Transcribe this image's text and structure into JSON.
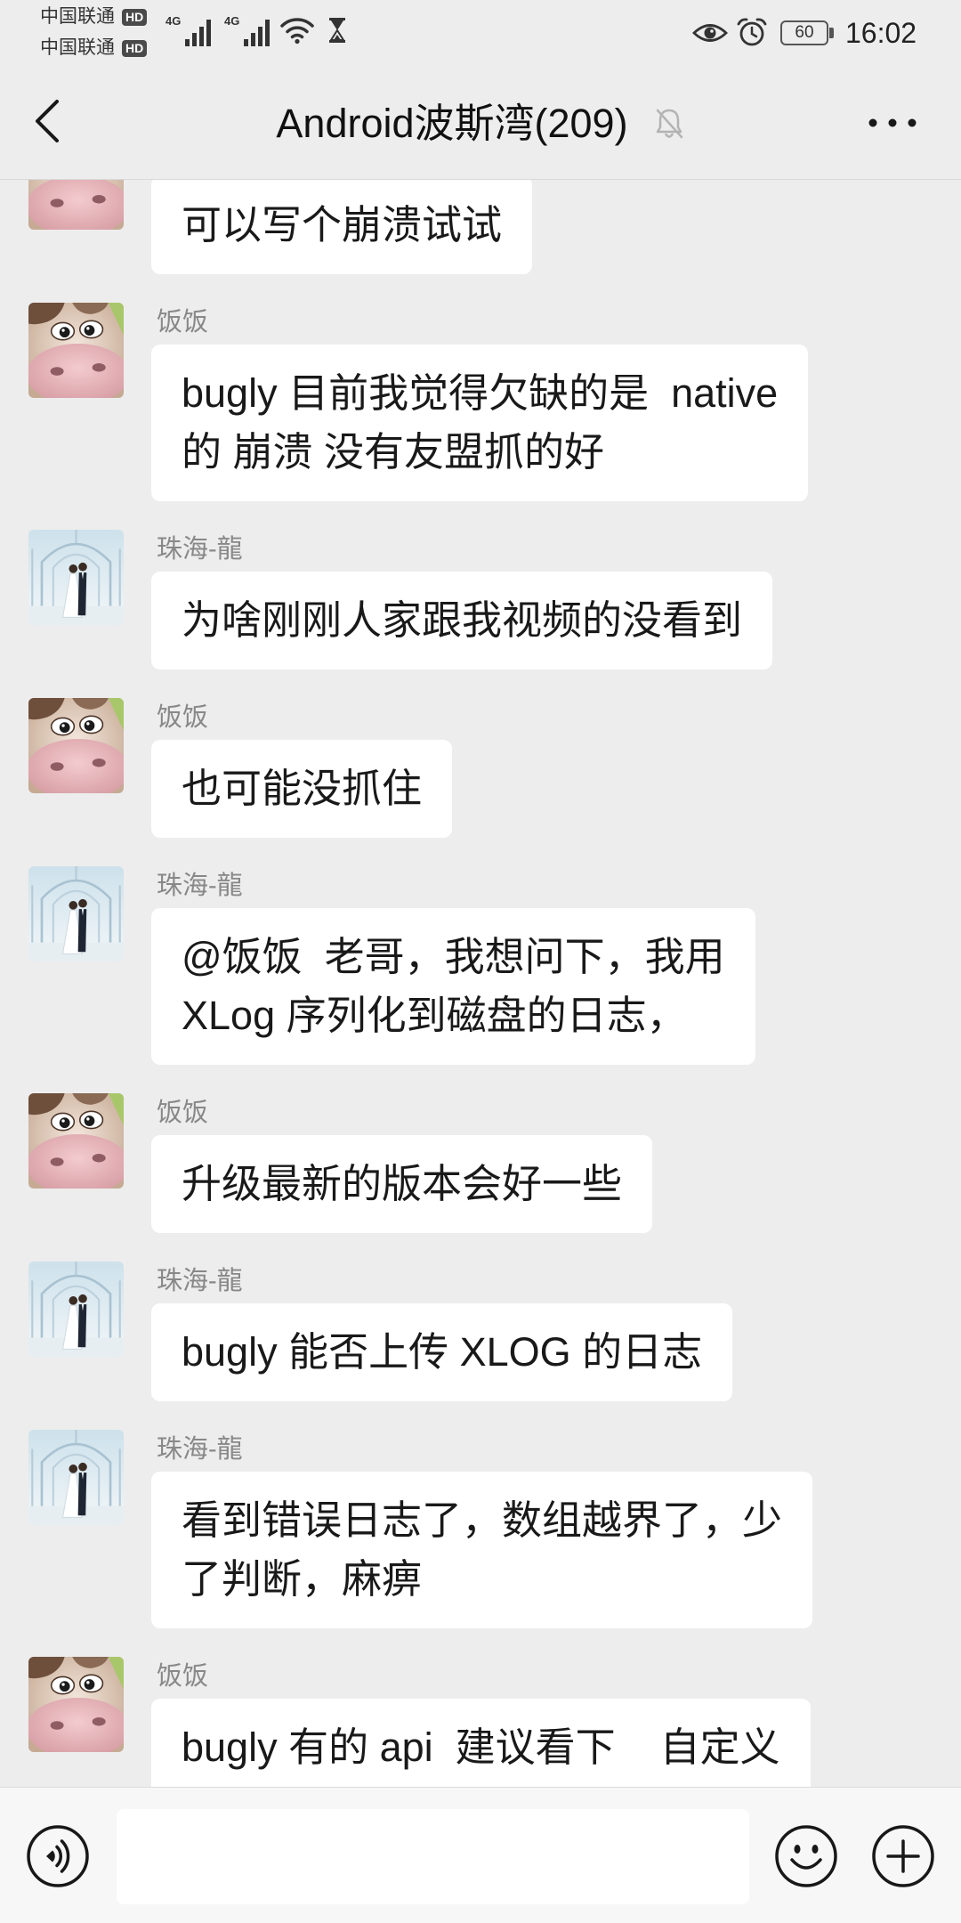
{
  "status_bar": {
    "carriers": [
      {
        "name": "中国联通",
        "badge": "HD"
      },
      {
        "name": "中国联通",
        "badge": "HD"
      }
    ],
    "networks": [
      "4G",
      "4G"
    ],
    "battery": "60",
    "time": "16:02",
    "icons": [
      "signal-icon",
      "wifi-icon",
      "hourglass-icon",
      "eye-icon",
      "alarm-icon",
      "battery-icon"
    ]
  },
  "header": {
    "title": "Android波斯湾(209)",
    "icons": {
      "back": "back-arrow-icon",
      "mute": "mute-bell-icon",
      "more": "more-dots-icon"
    }
  },
  "messages": [
    {
      "avatar": "cow-avatar",
      "lines": [
        "可以写个崩溃试试"
      ]
    },
    {
      "sender": "饭饭",
      "avatar": "cow-avatar",
      "lines": [
        "bugly 目前我觉得欠缺的是  native",
        "的 崩溃 没有友盟抓的好"
      ]
    },
    {
      "sender": "珠海-龍",
      "avatar": "wedding-avatar",
      "lines": [
        "为啥刚刚人家跟我视频的没看到"
      ]
    },
    {
      "sender": "饭饭",
      "avatar": "cow-avatar",
      "lines": [
        "也可能没抓住"
      ]
    },
    {
      "sender": "珠海-龍",
      "avatar": "wedding-avatar",
      "lines": [
        "@饭饭  老哥，我想问下，我用",
        "XLog 序列化到磁盘的日志，"
      ]
    },
    {
      "sender": "饭饭",
      "avatar": "cow-avatar",
      "lines": [
        "升级最新的版本会好一些"
      ]
    },
    {
      "sender": "珠海-龍",
      "avatar": "wedding-avatar",
      "lines": [
        "bugly 能否上传 XLOG 的日志"
      ]
    },
    {
      "sender": "珠海-龍",
      "avatar": "wedding-avatar",
      "lines": [
        "看到错误日志了，数组越界了，少",
        "了判断，麻痹"
      ]
    },
    {
      "sender": "饭饭",
      "avatar": "cow-avatar",
      "lines": [
        "bugly 有的 api  建议看下    自定义"
      ]
    }
  ],
  "input_bar": {
    "icons": {
      "voice": "voice-icon",
      "emoji": "emoji-icon",
      "plus": "plus-icon"
    }
  },
  "colors": {
    "background": "#ededed",
    "bubble": "#ffffff",
    "message_text": "#191919",
    "sender_name": "#888888",
    "input_bar": "#f7f7f7"
  }
}
